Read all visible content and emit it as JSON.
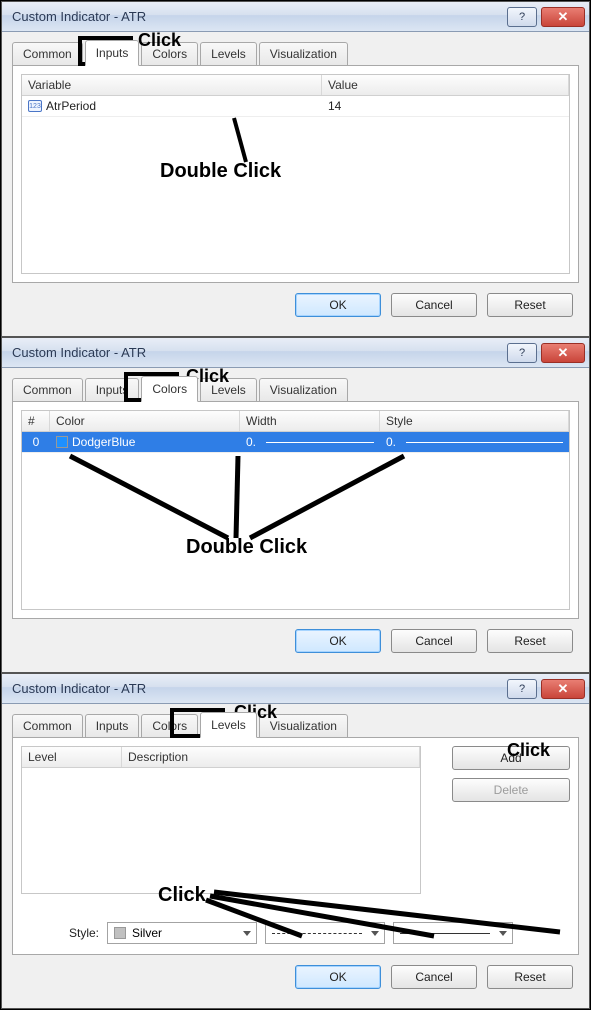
{
  "dialogs": [
    {
      "title": "Custom Indicator - ATR",
      "tabs": [
        "Common",
        "Inputs",
        "Colors",
        "Levels",
        "Visualization"
      ],
      "active_tab": 1,
      "inputs_table": {
        "headers": [
          "Variable",
          "Value"
        ],
        "rows": [
          {
            "icon": "123",
            "variable": "AtrPeriod",
            "value": "14"
          }
        ]
      },
      "buttons": {
        "ok": "OK",
        "cancel": "Cancel",
        "reset": "Reset"
      },
      "annotations": {
        "click_label": "Click",
        "dblclick_label": "Double Click"
      }
    },
    {
      "title": "Custom Indicator - ATR",
      "tabs": [
        "Common",
        "Inputs",
        "Colors",
        "Levels",
        "Visualization"
      ],
      "active_tab": 2,
      "colors_table": {
        "headers": [
          "#",
          "Color",
          "Width",
          "Style"
        ],
        "rows": [
          {
            "num": "0",
            "color_name": "DodgerBlue",
            "color_hex": "#1e90ff",
            "width": "0.",
            "style": "0."
          }
        ]
      },
      "buttons": {
        "ok": "OK",
        "cancel": "Cancel",
        "reset": "Reset"
      },
      "annotations": {
        "click_label": "Click",
        "dblclick_label": "Double Click"
      }
    },
    {
      "title": "Custom Indicator - ATR",
      "tabs": [
        "Common",
        "Inputs",
        "Colors",
        "Levels",
        "Visualization"
      ],
      "active_tab": 3,
      "levels_table": {
        "headers": [
          "Level",
          "Description"
        ]
      },
      "side_buttons": {
        "add": "Add",
        "delete": "Delete"
      },
      "style_label": "Style:",
      "style_color": {
        "name": "Silver",
        "hex": "#c0c0c0"
      },
      "buttons": {
        "ok": "OK",
        "cancel": "Cancel",
        "reset": "Reset"
      },
      "annotations": {
        "click_label": "Click",
        "click_label2": "Click",
        "click_label3": "Click"
      }
    }
  ],
  "win_help_glyph": "?",
  "win_close_glyph": "✕"
}
